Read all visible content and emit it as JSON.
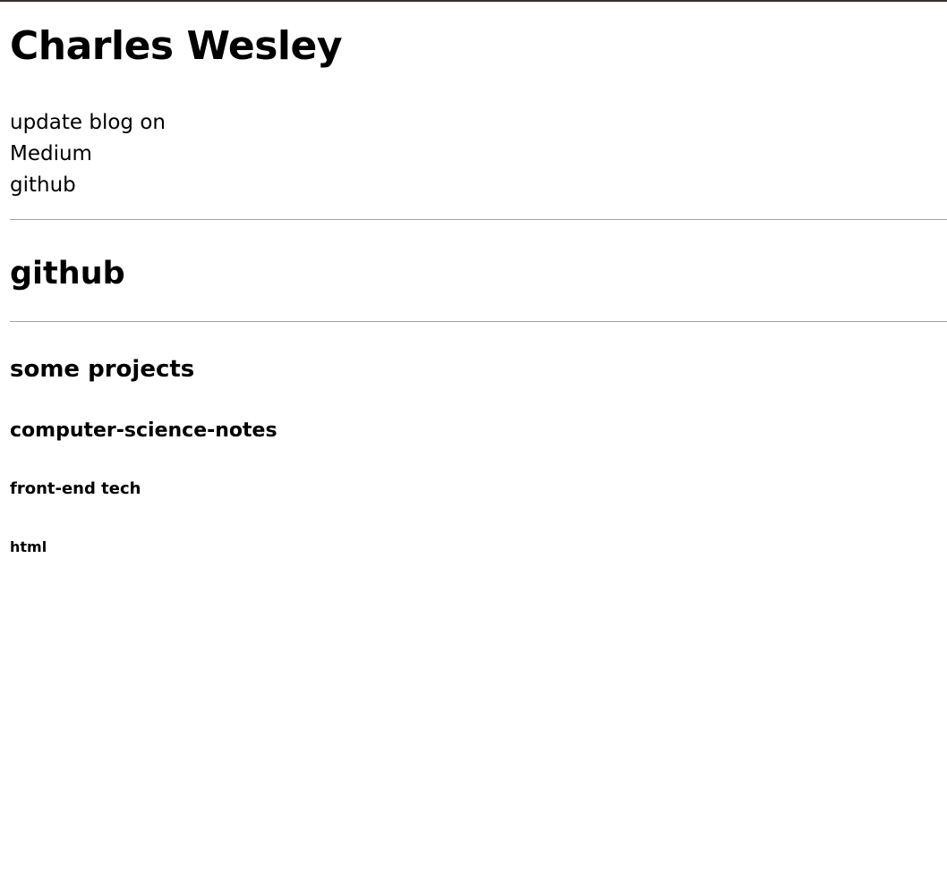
{
  "header": {
    "title": "Charles Wesley"
  },
  "intro": {
    "lines": [
      "update blog on",
      "Medium",
      "github"
    ]
  },
  "sections": {
    "github_heading": "github",
    "projects_heading": "some projects",
    "notes_heading": "computer-science-notes",
    "frontend_heading": "front-end tech",
    "html_heading": "html"
  },
  "colors": {
    "top_border": "#3a2e2b",
    "rule": "#a0a0a0",
    "text": "#000000",
    "background": "#ffffff"
  }
}
